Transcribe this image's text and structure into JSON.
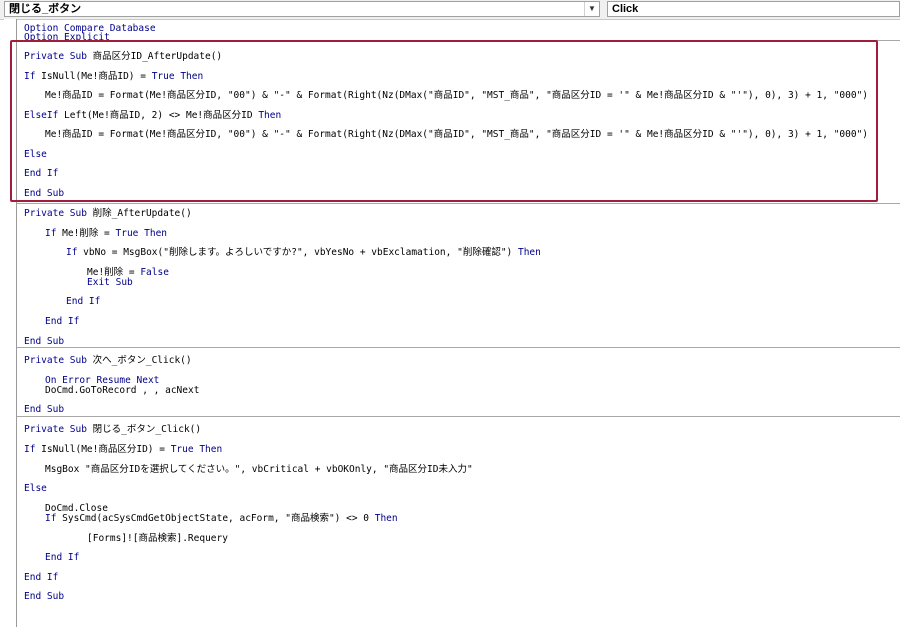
{
  "object_box": {
    "value": "閉じる_ボタン"
  },
  "procedure_box": {
    "value": "Click"
  },
  "code": {
    "l01": [
      [
        "Option Compare Database",
        "kw"
      ]
    ],
    "l02": [
      [
        "Option Explicit",
        "kw"
      ]
    ],
    "l03": [
      [
        "Private Sub",
        "kw"
      ],
      [
        " 商品区分ID_AfterUpdate()",
        ""
      ]
    ],
    "l04": [
      [
        "If",
        "kw"
      ],
      [
        " IsNull(Me!商品ID) = ",
        ""
      ],
      [
        "True",
        "kw"
      ],
      [
        " ",
        ""
      ],
      [
        "Then",
        "kw"
      ]
    ],
    "l05": [
      [
        "Me!商品ID = Format(Me!商品区分ID, \"00\") & \"-\" & Format(Right(Nz(DMax(\"商品ID\", \"MST_商品\", \"商品区分ID = '\" & Me!商品区分ID & \"'\"), 0), 3) + 1, \"000\")",
        ""
      ]
    ],
    "l06": [
      [
        "ElseIf",
        "kw"
      ],
      [
        " Left(Me!商品ID, 2) <> Me!商品区分ID ",
        ""
      ],
      [
        "Then",
        "kw"
      ]
    ],
    "l07": [
      [
        "Me!商品ID = Format(Me!商品区分ID, \"00\") & \"-\" & Format(Right(Nz(DMax(\"商品ID\", \"MST_商品\", \"商品区分ID = '\" & Me!商品区分ID & \"'\"), 0), 3) + 1, \"000\")",
        ""
      ]
    ],
    "l08": [
      [
        "Else",
        "kw"
      ]
    ],
    "l09": [
      [
        "End If",
        "kw"
      ]
    ],
    "l10": [
      [
        "End Sub",
        "kw"
      ]
    ],
    "l11": [
      [
        "Private Sub",
        "kw"
      ],
      [
        " 削除_AfterUpdate()",
        ""
      ]
    ],
    "l12": [
      [
        "If",
        "kw"
      ],
      [
        " Me!削除 = ",
        ""
      ],
      [
        "True",
        "kw"
      ],
      [
        " ",
        ""
      ],
      [
        "Then",
        "kw"
      ]
    ],
    "l13": [
      [
        "If",
        "kw"
      ],
      [
        " vbNo = MsgBox(\"削除します。よろしいですか?\", vbYesNo + vbExclamation, \"削除確認\") ",
        ""
      ],
      [
        "Then",
        "kw"
      ]
    ],
    "l14": [
      [
        "Me!削除 = ",
        ""
      ],
      [
        "False",
        "kw"
      ]
    ],
    "l15": [
      [
        "Exit Sub",
        "kw"
      ]
    ],
    "l16": [
      [
        "End If",
        "kw"
      ]
    ],
    "l17": [
      [
        "End If",
        "kw"
      ]
    ],
    "l18": [
      [
        "End Sub",
        "kw"
      ]
    ],
    "l19": [
      [
        "Private Sub",
        "kw"
      ],
      [
        " 次へ_ボタン_Click()",
        ""
      ]
    ],
    "l20": [
      [
        "On Error Resume Next",
        "kw"
      ]
    ],
    "l21": [
      [
        "DoCmd.GoToRecord , , acNext",
        ""
      ]
    ],
    "l22": [
      [
        "End Sub",
        "kw"
      ]
    ],
    "l23": [
      [
        "Private Sub",
        "kw"
      ],
      [
        " 閉じる_ボタン_Click()",
        ""
      ]
    ],
    "l24": [
      [
        "If",
        "kw"
      ],
      [
        " IsNull(Me!商品区分ID) = ",
        ""
      ],
      [
        "True",
        "kw"
      ],
      [
        " ",
        ""
      ],
      [
        "Then",
        "kw"
      ]
    ],
    "l25": [
      [
        "MsgBox \"商品区分IDを選択してください。\", vbCritical + vbOKOnly, \"商品区分ID未入力\"",
        ""
      ]
    ],
    "l26": [
      [
        "Else",
        "kw"
      ]
    ],
    "l27": [
      [
        "DoCmd.Close",
        ""
      ]
    ],
    "l28": [
      [
        "If",
        "kw"
      ],
      [
        " SysCmd(acSysCmdGetObjectState, acForm, \"商品検索\") <> 0 ",
        ""
      ],
      [
        "Then",
        "kw"
      ]
    ],
    "l29": [
      [
        "[Forms]![商品検索].Requery",
        ""
      ]
    ],
    "l30": [
      [
        "End If",
        "kw"
      ]
    ],
    "l31": [
      [
        "End If",
        "kw"
      ]
    ],
    "l32": [
      [
        "End Sub",
        "kw"
      ]
    ]
  }
}
